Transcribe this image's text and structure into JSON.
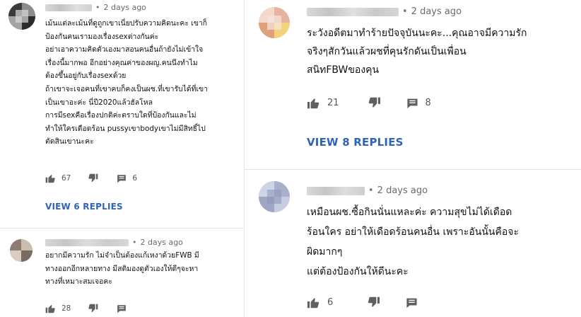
{
  "left_column": {
    "comments": [
      {
        "time": "2 days ago",
        "text": "เม้นแต่ละเม้นที่ดูถูกเขาเนี่ยปรับความคิดนะคะ เขาก็\nป้องกันคนเรามองเรื่องsexต่างกันค่ะ\nอย่าเอาความคิดตัวเองมาสอนคนอื่นถ้ายังไม่เข้าใจ\nเรื่องนี้มากพอ อีกอย่างคุณค่าของผญ.คนนึงทำไม\nต้องขึ้นอยู่กับเรื่องsexด้วย\nถ้าเขาจะเจอคนที่เขาคบก็คงเป็นผช.ที่เขารับได้ที่เขา\nเป็นเขาอะค่ะ นี่ปี2020แล้วฮัลโหล\nการมีsexคือเรื่องปกติค่ะตราบใดที่ป้องกันและไม่\nทำให้ใครเดือดร้อน pussyเขาbodyเขาไม่มีสิทธิ์ไป\nตัดสินเขานะคะ",
        "likes": "67",
        "replies_count": "6",
        "view_replies": "VIEW 6 REPLIES"
      },
      {
        "time": "2 days ago",
        "text": "อยากมีความรัก ไม่จำเป็นต้องแก้เหงาด้วยFWB มี\nทางออกอีกหลายทาง มีสติมองดูตัวเองให้ดีๆจะหา\nทางที่เหมาะสมเจอคะ",
        "likes": "28"
      }
    ]
  },
  "right_column": {
    "comments": [
      {
        "time": "2 days ago",
        "text": "ระวังอดีตมาทำร้ายปัจจุบันนะคะ...คุณอาจมีความรัก\nจริงๆสักวันแล้วผชที่คุนรักดันเป็นเพื่อน\nสนิทFBWของคุน",
        "likes": "21",
        "replies_count": "8",
        "view_replies": "VIEW 8 REPLIES"
      },
      {
        "time": "2 days ago",
        "text": "เหมือนผช.ซื้อกินนั่นแหละค่ะ ความสุขไม่ได้เดือด\nร้อนใคร อย่าให้เดือดร้อนคนอื่น เพราะอันนั้นคือจะ\nผิดมากๆ\nแต่ต้องป้องกันให้ดีนะคะ",
        "likes": "6"
      }
    ]
  },
  "icons": {
    "like": "thumbs-up-icon",
    "dislike": "thumbs-down-icon",
    "reply": "comment-icon"
  },
  "colors": {
    "link": "#2f63b8",
    "icon": "#606060",
    "meta": "#6b6b6b"
  }
}
